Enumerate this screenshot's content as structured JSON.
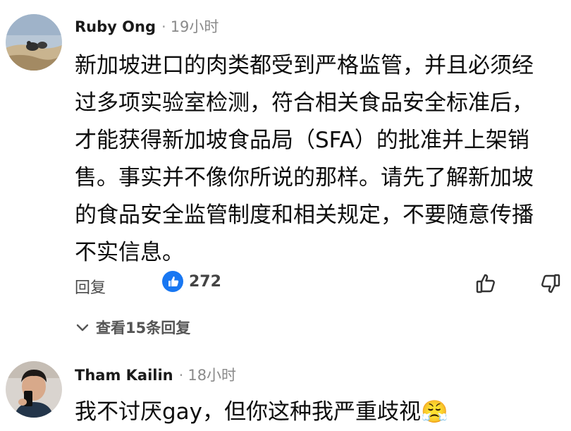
{
  "comments": [
    {
      "author": "Ruby Ong",
      "separator": "·",
      "time": "19小时",
      "text_lines": [
        "新加坡进口的肉类都受到严格监管，并且必须经",
        "过多项实验室检测，符合相关食品安全标准后，",
        "才能获得新加坡食品局（SFA）的批准并上架销",
        "售。事实并不像你所说的那样。请先了解新加坡",
        "的食品安全监管制度和相关规定，不要随意传播",
        "不实信息。"
      ],
      "reply_label": "回复",
      "like_count": "272",
      "view_replies": "查看15条回复"
    },
    {
      "author": "Tham Kailin",
      "separator": "·",
      "time": "18小时",
      "text": "我不讨厌gay，但你这种我严重歧视",
      "emoji": "😤"
    }
  ],
  "colors": {
    "like_blue": "#1877F2",
    "icon_gray": "#333333"
  }
}
